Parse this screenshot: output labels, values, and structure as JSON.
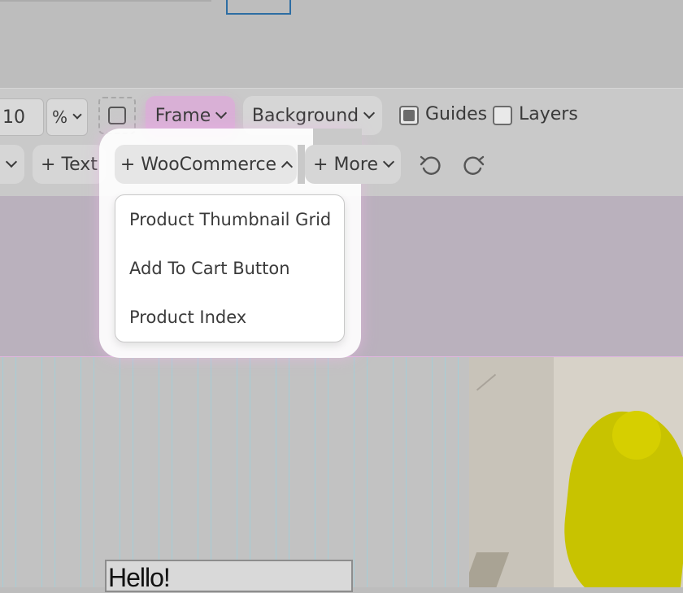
{
  "toolbar": {
    "size_value": "10",
    "unit": "%",
    "frame_label": "Frame",
    "background_label": "Background",
    "guides_label": "Guides",
    "guides_checked": true,
    "layers_label": "Layers",
    "layers_checked": false,
    "text_label": "+ Text",
    "woocommerce_label": "+ WooCommerce",
    "more_label": "+ More",
    "undo_icon": "undo-icon",
    "redo_icon": "redo-icon"
  },
  "dropdown": {
    "items": [
      {
        "label": "Product Thumbnail Grid"
      },
      {
        "label": "Add To Cart Button"
      },
      {
        "label": "Product Index"
      }
    ]
  },
  "canvas": {
    "heading_text": "Hello!"
  },
  "colors": {
    "accent_frame": "#d9b0d6",
    "selection_border": "#2d6da3",
    "guide_lines": "#a6cdd6"
  }
}
